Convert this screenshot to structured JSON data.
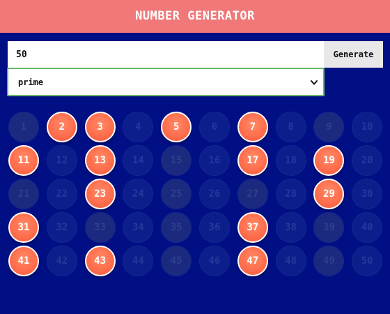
{
  "header": {
    "title": "NUMBER GENERATOR"
  },
  "controls": {
    "count_value": "50",
    "generate_label": "Generate",
    "type_selected": "prime"
  },
  "grid": {
    "highlight_color": "#ff6e4e",
    "background_color": "#000f84",
    "balls": [
      {
        "label": "1",
        "highlighted": false,
        "tone": "v3"
      },
      {
        "label": "2",
        "highlighted": true
      },
      {
        "label": "3",
        "highlighted": true
      },
      {
        "label": "4",
        "highlighted": false,
        "tone": "v0"
      },
      {
        "label": "5",
        "highlighted": true
      },
      {
        "label": "6",
        "highlighted": false,
        "tone": "v0"
      },
      {
        "label": "7",
        "highlighted": true
      },
      {
        "label": "8",
        "highlighted": false,
        "tone": "v0"
      },
      {
        "label": "9",
        "highlighted": false,
        "tone": "v3"
      },
      {
        "label": "10",
        "highlighted": false,
        "tone": "v0"
      },
      {
        "label": "11",
        "highlighted": true
      },
      {
        "label": "12",
        "highlighted": false,
        "tone": "v0"
      },
      {
        "label": "13",
        "highlighted": true
      },
      {
        "label": "14",
        "highlighted": false,
        "tone": "v0"
      },
      {
        "label": "15",
        "highlighted": false,
        "tone": "v3"
      },
      {
        "label": "16",
        "highlighted": false,
        "tone": "v0"
      },
      {
        "label": "17",
        "highlighted": true
      },
      {
        "label": "18",
        "highlighted": false,
        "tone": "v0"
      },
      {
        "label": "19",
        "highlighted": true
      },
      {
        "label": "20",
        "highlighted": false,
        "tone": "v0"
      },
      {
        "label": "21",
        "highlighted": false,
        "tone": "v3"
      },
      {
        "label": "22",
        "highlighted": false,
        "tone": "v0"
      },
      {
        "label": "23",
        "highlighted": true
      },
      {
        "label": "24",
        "highlighted": false,
        "tone": "v0"
      },
      {
        "label": "25",
        "highlighted": false,
        "tone": "v3"
      },
      {
        "label": "26",
        "highlighted": false,
        "tone": "v0"
      },
      {
        "label": "27",
        "highlighted": false,
        "tone": "v3"
      },
      {
        "label": "28",
        "highlighted": false,
        "tone": "v0"
      },
      {
        "label": "29",
        "highlighted": true
      },
      {
        "label": "30",
        "highlighted": false,
        "tone": "v0"
      },
      {
        "label": "31",
        "highlighted": true
      },
      {
        "label": "32",
        "highlighted": false,
        "tone": "v0"
      },
      {
        "label": "33",
        "highlighted": false,
        "tone": "v3"
      },
      {
        "label": "34",
        "highlighted": false,
        "tone": "v0"
      },
      {
        "label": "35",
        "highlighted": false,
        "tone": "v3"
      },
      {
        "label": "36",
        "highlighted": false,
        "tone": "v0"
      },
      {
        "label": "37",
        "highlighted": true
      },
      {
        "label": "38",
        "highlighted": false,
        "tone": "v0"
      },
      {
        "label": "39",
        "highlighted": false,
        "tone": "v3"
      },
      {
        "label": "40",
        "highlighted": false,
        "tone": "v0"
      },
      {
        "label": "41",
        "highlighted": true
      },
      {
        "label": "42",
        "highlighted": false,
        "tone": "v0"
      },
      {
        "label": "43",
        "highlighted": true
      },
      {
        "label": "44",
        "highlighted": false,
        "tone": "v0"
      },
      {
        "label": "45",
        "highlighted": false,
        "tone": "v3"
      },
      {
        "label": "46",
        "highlighted": false,
        "tone": "v0"
      },
      {
        "label": "47",
        "highlighted": true
      },
      {
        "label": "48",
        "highlighted": false,
        "tone": "v0"
      },
      {
        "label": "49",
        "highlighted": false,
        "tone": "v3"
      },
      {
        "label": "50",
        "highlighted": false,
        "tone": "v0"
      }
    ]
  }
}
